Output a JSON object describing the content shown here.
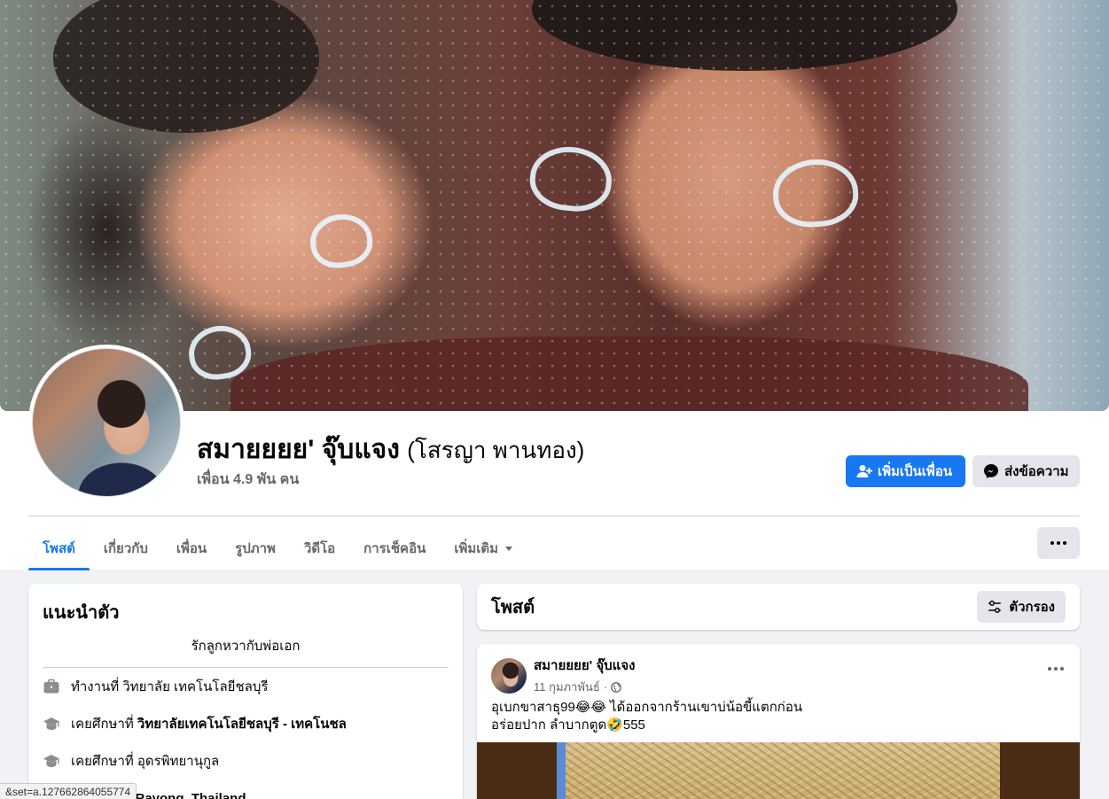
{
  "profile": {
    "name": "สมายยยย' จุ๊บแจง",
    "alternate_name": "(โสรญา พานทอง)",
    "friends": "เพื่อน 4.9 พัน คน"
  },
  "actions": {
    "add_friend": "เพิ่มเป็นเพื่อน",
    "message": "ส่งข้อความ"
  },
  "tabs": [
    {
      "label": "โพสต์",
      "active": true
    },
    {
      "label": "เกี่ยวกับ"
    },
    {
      "label": "เพื่อน"
    },
    {
      "label": "รูปภาพ"
    },
    {
      "label": "วิดีโอ"
    },
    {
      "label": "การเช็คอิน"
    },
    {
      "label": "เพิ่มเติม"
    }
  ],
  "intro": {
    "title": "แนะนำตัว",
    "bio": "รักลูกหวากับพ่อเอก",
    "items": [
      {
        "icon": "briefcase-icon",
        "prefix": "ทำงานที่ ",
        "value": "วิทยาลัย เทคโนโลยีชลบุรี",
        "bold": false
      },
      {
        "icon": "graduation-cap-icon",
        "prefix": "เคยศึกษาที่ ",
        "value": "วิทยาลัยเทคโนโลยีชลบุรี - เทคโนชล",
        "bold": true
      },
      {
        "icon": "graduation-cap-icon",
        "prefix": "เคยศึกษาที่ ",
        "value": "อุดรพิทยานุกูล",
        "bold": false
      },
      {
        "icon": "location-icon",
        "prefix": "",
        "value": "Rayohng, Rayong, Thailand",
        "bold": false
      }
    ]
  },
  "posts_header": {
    "title": "โพสต์",
    "filter_label": "ตัวกรอง"
  },
  "post": {
    "author": "สมายยยย' จุ๊บแจง",
    "date": "11 กุมภาพันธ์",
    "line1": "อุเบกขาสาธุ99😂😂 ได้ออกจากร้านเขาบ่น้อขี้แตกก่อน",
    "line2": "อร่อยปาก ลำบากตูด🤣555"
  },
  "status_url": "&set=a.127662864055774",
  "colors": {
    "accent": "#1877f2",
    "background": "#f0f2f5",
    "secondary_button": "#e4e6eb",
    "muted_text": "#65676b"
  }
}
